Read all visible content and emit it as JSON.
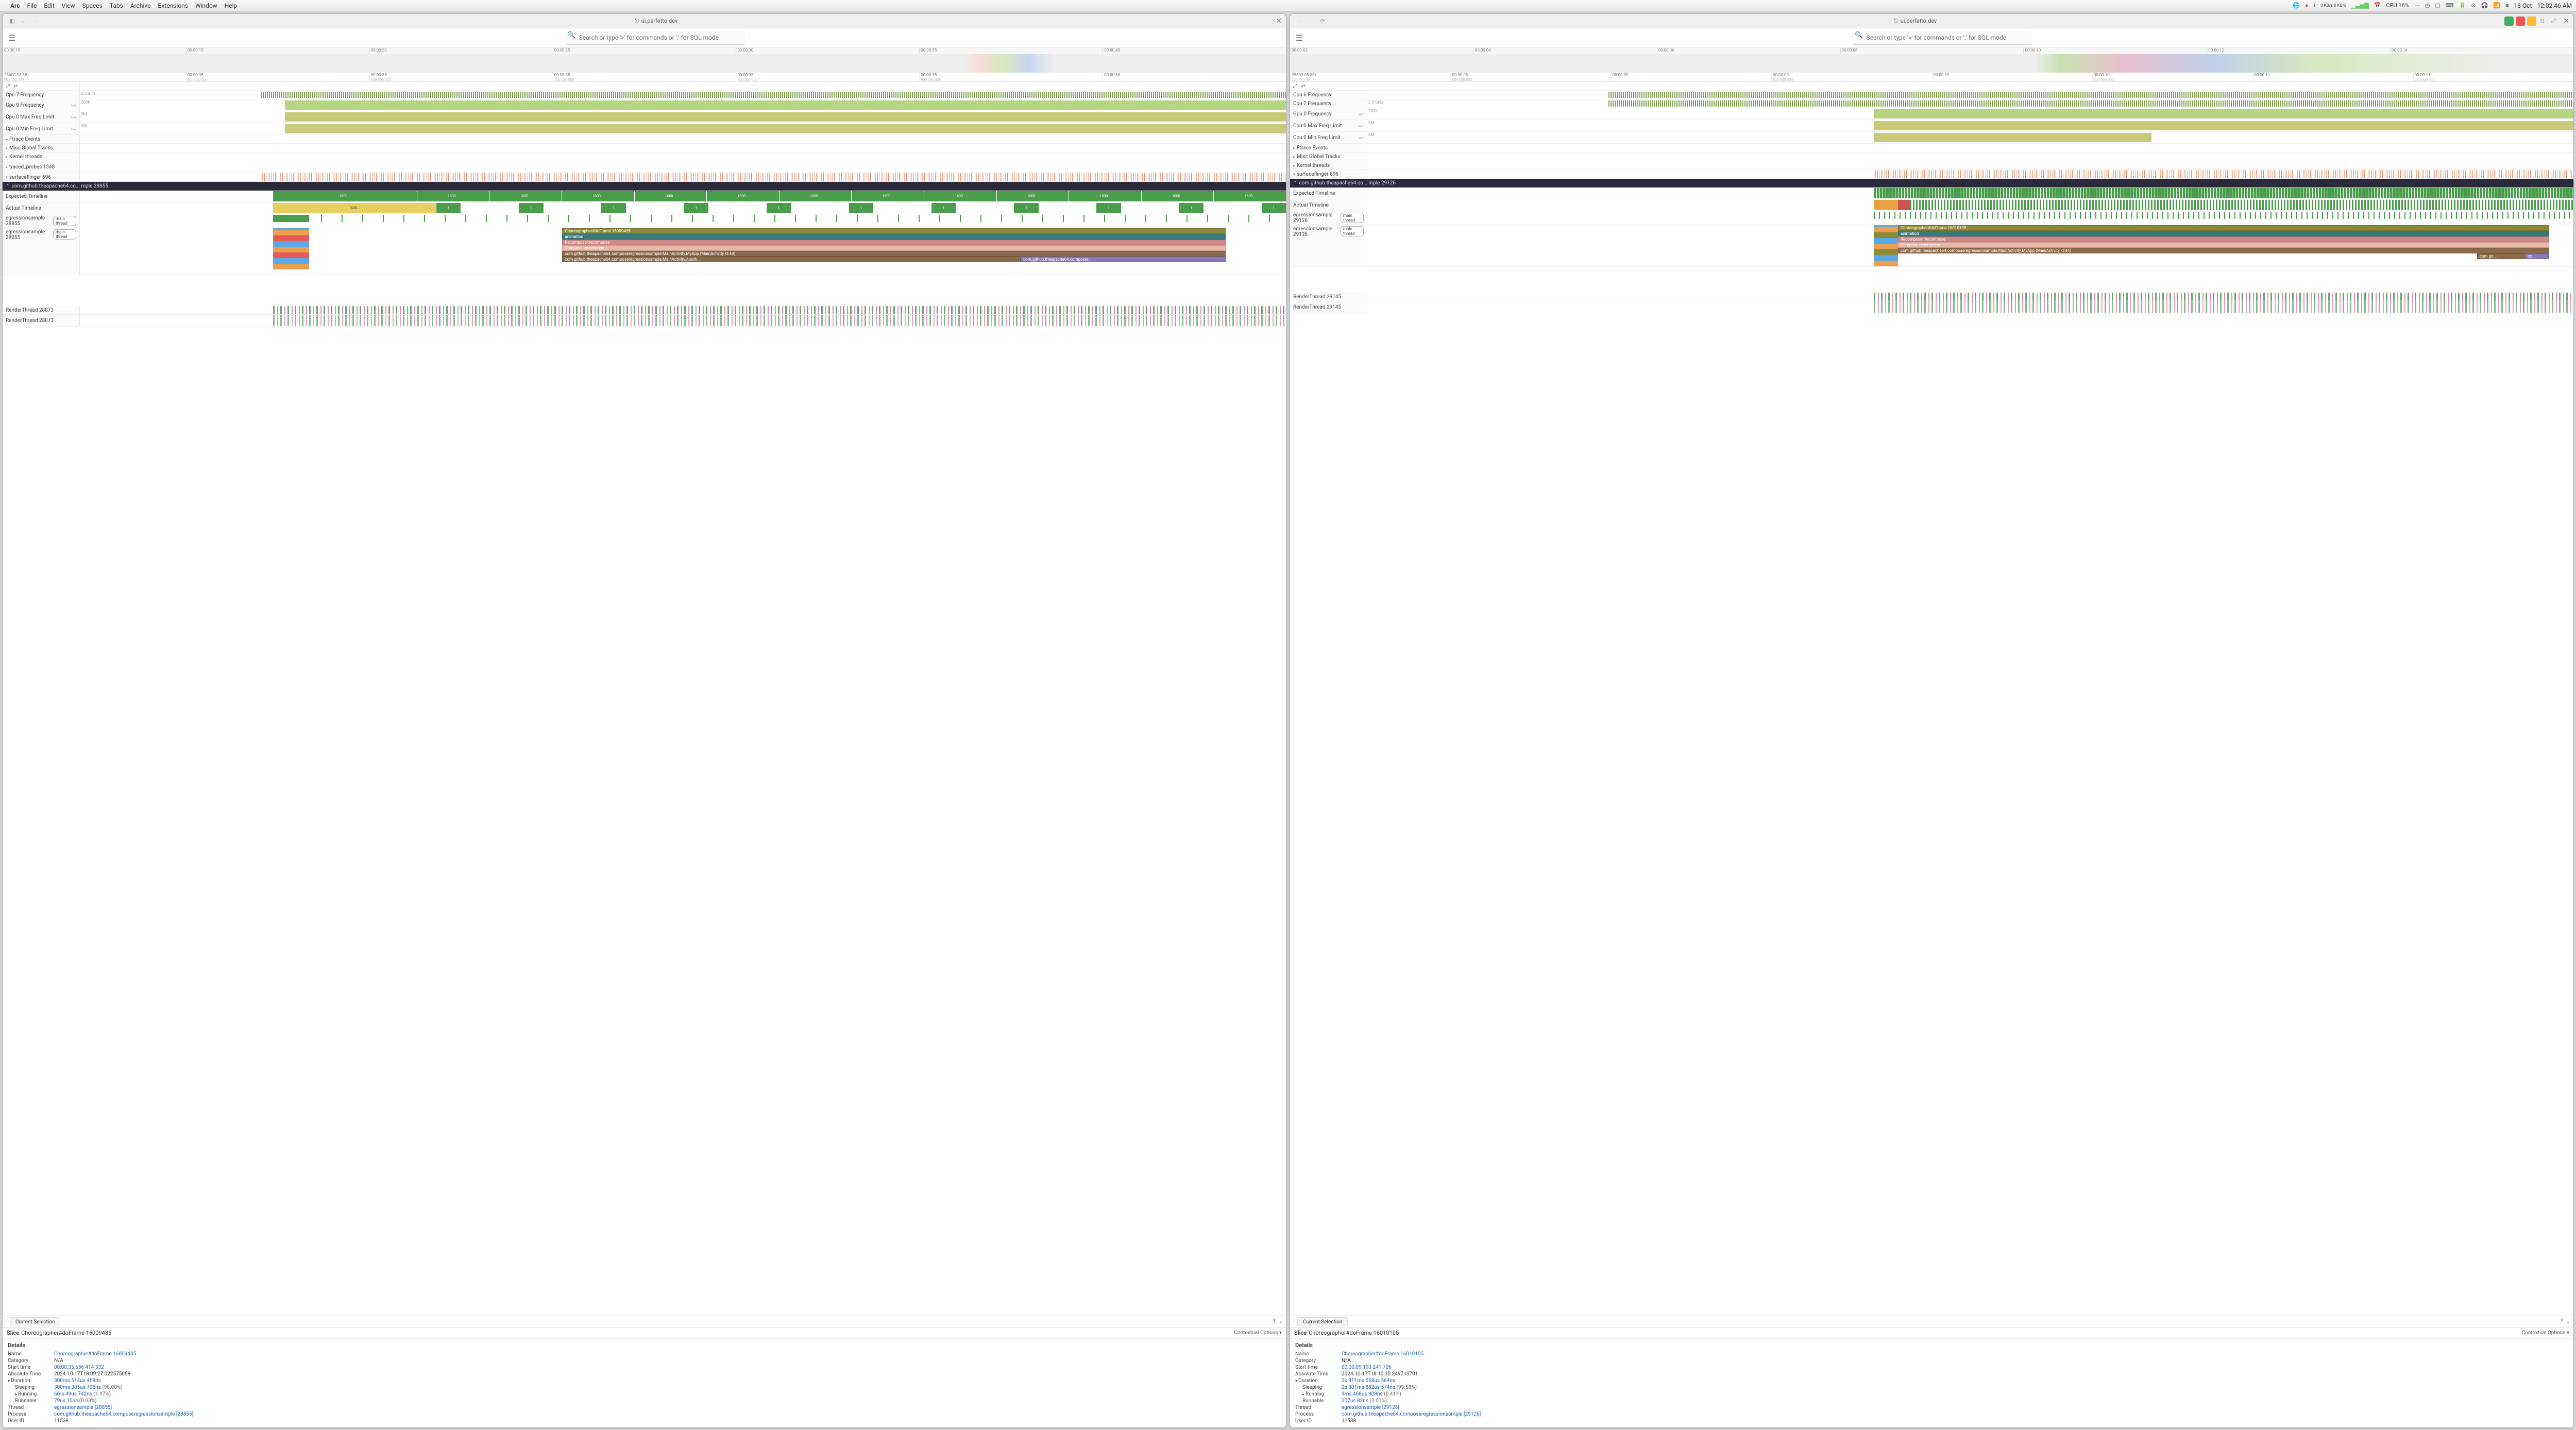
{
  "menubar": {
    "app": "Arc",
    "items": [
      "File",
      "Edit",
      "View",
      "Spaces",
      "Tabs",
      "Archive",
      "Extensions",
      "Window",
      "Help"
    ],
    "net": "0 KB/s\n0 KB/s",
    "cpu": "CPU 16%",
    "date": "18 Oct",
    "time": "12:02:46 AM"
  },
  "windows": [
    {
      "url": "ui.perfetto.dev",
      "search_placeholder": "Search or type '>' for commands or ':' for SQL mode",
      "overview_ticks": [
        "00:00:10",
        "00:00:15",
        "00:00:20",
        "00:00:25",
        "00:00:30",
        "00:00:35",
        "00:00:40"
      ],
      "ruler_ticks": [
        {
          "t": "26600:03:35+",
          "s": "905 162 449"
        },
        {
          "t": "00:00:35",
          "s": "500 000 000"
        },
        {
          "t": "00:00:35",
          "s": "600 000 000"
        },
        {
          "t": "00:00:35",
          "s": "700 000 000"
        },
        {
          "t": "00:00:35",
          "s": "800 000 000"
        },
        {
          "t": "00:00:35",
          "s": "900 000 000"
        },
        {
          "t": "00:00:36",
          "s": ""
        }
      ],
      "tracks": {
        "cpu7_freq": "Cpu 7 Frequency",
        "cpu7_val": "2.5 GHz",
        "gpu0_freq": "Gpu 0 Frequency",
        "gpu0_val": "200K",
        "cpu0_max": "Cpu 0 Max Freq Limit",
        "cpu0_max_val": "2M",
        "cpu0_min": "Cpu 0 Min Freq Limit",
        "cpu0_min_val": "2M",
        "ftrace": "Ftrace Events",
        "misc": "Misc Global Tracks",
        "kernel": "Kernel threads",
        "traced": "traced_probes 1348",
        "sf": "surfaceflinger 696"
      },
      "process_header": "com.github.theapache64.co...  mple 28855",
      "expected_timeline": "Expected Timeline",
      "actual_timeline": "Actual Timeline",
      "frame_label": "1600...",
      "thread1": "egressionsample 28855",
      "thread2": "egressionsample 28855",
      "main_thread": "main thread",
      "flame": {
        "f0": "Choreographer#doFrame 16009435",
        "f1": "animation",
        "f2": "Recomposer:recompose",
        "f3": "Compose:recompose",
        "f4": "com.github.theapache64.composeregressionsample.MainActivity.MyApp (MainActivity.kt:44)",
        "f5a": "com.github.theapache64.composeregressionsample.MainActivity.Anoth...",
        "f5b": "com.github.theapache64.composer..."
      },
      "render1": "RenderThread 28873",
      "render2": "RenderThread 28873",
      "panel": {
        "tab": "Current Selection",
        "slice_word": "Slice",
        "slice_name": "Choreographer#doFrame 16009435",
        "ctx": "Contextual Options",
        "details": "Details",
        "rows": [
          {
            "k": "Name",
            "v": "Choreographer#doFrame 16009435",
            "link": true
          },
          {
            "k": "Category",
            "v": "N/A"
          },
          {
            "k": "Start time",
            "v": "00:00:35.656 414 332",
            "link": true
          },
          {
            "k": "Absolute Time",
            "v": "2024-10-17T18:09:27.022575058"
          },
          {
            "k": "Duration",
            "v": "306ms 514us 458ns",
            "link": true,
            "expand": "down"
          },
          {
            "k": "Sleeping",
            "v": "300ms 385us 706ns",
            "pct": "(98.00%)",
            "link": true,
            "indent": true
          },
          {
            "k": "Running",
            "v": "6ms 49us 742ns",
            "pct": "(1.97%)",
            "link": true,
            "indent": true,
            "expand": "right"
          },
          {
            "k": "Runnable",
            "v": "79us 10ns",
            "pct": "(0.03%)",
            "link": true,
            "indent": true
          },
          {
            "k": "Thread",
            "v": "egressionsample [28855]",
            "link": true
          },
          {
            "k": "Process",
            "v": "com.github.theapache64.composeregressionsample [28855]",
            "link": true
          },
          {
            "k": "User ID",
            "v": "11538"
          }
        ]
      }
    },
    {
      "url": "ui.perfetto.dev",
      "search_placeholder": "Search or type '>' for commands or ':' for SQL mode",
      "overview_ticks": [
        "00:00:02",
        "00:00:04",
        "00:00:06",
        "00:00:08",
        "00:00:10",
        "00:00:12",
        "00:00:14"
      ],
      "ruler_ticks": [
        {
          "t": "25600:05:05+",
          "s": "305 474 394"
        },
        {
          "t": "00:00:08",
          "s": "500 000 000"
        },
        {
          "t": "00:00:09",
          "s": ""
        },
        {
          "t": "00:00:09",
          "s": "500 000 000"
        },
        {
          "t": "00:00:10",
          "s": ""
        },
        {
          "t": "00:00:10",
          "s": "500 000 000"
        },
        {
          "t": "00:00:11",
          "s": ""
        },
        {
          "t": "00:00:11",
          "s": "500 000 000"
        }
      ],
      "tracks": {
        "cpu6_freq": "Cpu 6 Frequency",
        "cpu7_freq": "Cpu 7 Frequency",
        "cpu7_val": "2.5 GHz",
        "gpu0_freq": "Gpu 0 Frequency",
        "gpu0_val": "200K",
        "cpu0_max": "Cpu 0 Max Freq Limit",
        "cpu0_max_val": "2M",
        "cpu0_min": "Cpu 0 Min Freq Limit",
        "cpu0_min_val": "2M",
        "ftrace": "Ftrace Events",
        "misc": "Misc Global Tracks",
        "kernel": "Kernel threads",
        "sf": "surfaceflinger 696"
      },
      "process_header": "com.github.theapache64.co...  mple 29126",
      "expected_timeline": "Expected Timeline",
      "actual_timeline": "Actual Timeline",
      "thread1": "egressionsample 29126",
      "thread2": "egressionsample 29126",
      "main_thread": "main thread",
      "flame": {
        "f0": "Choreographer#doFrame 16010105",
        "f1": "animation",
        "f2": "Recomposer:recompose",
        "f3": "Compose:recompose",
        "f4": "com.github.theapache64.composeregressionsample.MainActivity.MyApp (MainActivity.kt:44)",
        "f5a": "com.git...",
        "f5b": "co..."
      },
      "render1": "RenderThread 29145",
      "render2": "RenderThread 29145",
      "panel": {
        "tab": "Current Selection",
        "slice_word": "Slice",
        "slice_name": "Choreographer#doFrame 16010105",
        "ctx": "Contextual Options",
        "details": "Details",
        "rows": [
          {
            "k": "Name",
            "v": "Choreographer#doFrame 16010105",
            "link": true
          },
          {
            "k": "Category",
            "v": "N/A"
          },
          {
            "k": "Start time",
            "v": "00:00:09.193 241 706",
            "link": true
          },
          {
            "k": "Absolute Time",
            "v": "2024-10-17T18:10:30.249713701"
          },
          {
            "k": "Duration",
            "v": "2s 311ms 558us 564ns",
            "link": true,
            "expand": "down"
          },
          {
            "k": "Sleeping",
            "v": "2s 301ms 882us 574ns",
            "pct": "(99.58%)",
            "link": true,
            "indent": true
          },
          {
            "k": "Running",
            "v": "9ms 468us 908ns",
            "pct": "(0.41%)",
            "link": true,
            "indent": true,
            "expand": "right"
          },
          {
            "k": "Runnable",
            "v": "207us 82ns",
            "pct": "(0.01%)",
            "link": true,
            "indent": true
          },
          {
            "k": "Thread",
            "v": "egressionsample [29126]",
            "link": true
          },
          {
            "k": "Process",
            "v": "com.github.theapache64.composeregressionsample [29126]",
            "link": true
          },
          {
            "k": "User ID",
            "v": "11538"
          }
        ]
      }
    }
  ]
}
